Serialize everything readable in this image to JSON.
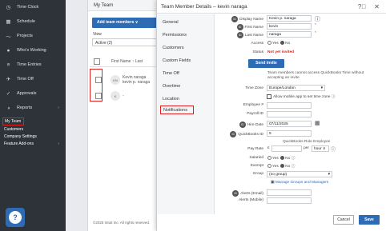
{
  "sidebar": {
    "items": [
      {
        "label": "Time Clock",
        "icon": "clock-icon"
      },
      {
        "label": "Schedule",
        "icon": "calendar-icon"
      },
      {
        "label": "Projects",
        "icon": "projects-icon"
      },
      {
        "label": "Who's Working",
        "icon": "location-pin-icon"
      },
      {
        "label": "Time Entries",
        "icon": "time-entries-icon"
      },
      {
        "label": "Time Off",
        "icon": "plane-icon"
      },
      {
        "label": "Approvals",
        "icon": "checkmark-icon"
      },
      {
        "label": "Reports",
        "icon": "pie-chart-icon"
      }
    ],
    "sections": [
      {
        "label": "My Team"
      },
      {
        "label": "Customers"
      },
      {
        "label": "Company Settings"
      },
      {
        "label": "Feature Add-ons"
      }
    ]
  },
  "main": {
    "title": "My Team",
    "add_button": "Add team members ∨",
    "view_label": "View",
    "view_value": "Active (2)",
    "col_header": "First Name ↑  Last",
    "rows": [
      {
        "initials": "KN",
        "name1": "Kevin naraga",
        "name2": "kevin p. naraga"
      },
      {
        "initials": "K",
        "name1": "-",
        "name2": ""
      }
    ],
    "footer": "©2025 Intuit Inc. All rights reserved."
  },
  "panel": {
    "title": "Team Member Details – kevin naraga",
    "tabs": [
      "General",
      "Permissions",
      "Customers",
      "Custom Fields",
      "Time Off",
      "Overtime",
      "Location",
      "Notifications"
    ],
    "form": {
      "display_name_label": "Display Name",
      "display_name_value": "Kevin p. naraga",
      "first_name_label": "First Name",
      "first_name_value": "kevin",
      "last_name_label": "Last Name",
      "last_name_value": "naraga",
      "access_label": "Access",
      "status_label": "Status",
      "status_value": "Not yet invited",
      "send_invite": "Send invite",
      "invite_note": "Team members cannot access QuickBooks Time without accepting an invite",
      "timezone_label": "Time Zone",
      "timezone_value": "Europe/London",
      "mobile_app_text": "Allow mobile app to set time zone",
      "employee_label": "Employee #",
      "payroll_label": "Payroll ID",
      "hire_date_label": "Hire Date",
      "hire_date_value": "07/11/2025",
      "qb_id_label": "QuickBooks ID",
      "qb_id_value": "5",
      "pay_rate_label": "Pay Rate",
      "qb_role_header": "QuickBooks Role",
      "employee_header": "Employee",
      "currency": "£",
      "per_label": "per",
      "per_value": "hour ∨",
      "salaried_label": "Salaried",
      "exempt_label": "Exempt",
      "yes": "Yes",
      "no": "No",
      "group_label": "Group",
      "group_value": "(no group)",
      "manage_groups": "Manage Groups and Managers",
      "alerts_email_label": "Alerts (Email)",
      "alerts_mobile_label": "Alerts (Mobile)"
    },
    "cancel": "Cancel",
    "save": "Save"
  },
  "colors": {
    "accent": "#2d6cb5",
    "highlight": "#e02020",
    "sidebar": "#2d3338",
    "error": "#e02020"
  }
}
